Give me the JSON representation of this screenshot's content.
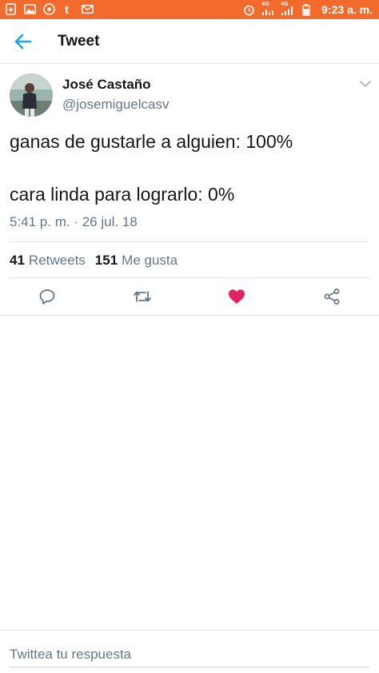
{
  "status_bar": {
    "time": "9:23 a. m.",
    "network_1": "4G",
    "network_2": "4G"
  },
  "header": {
    "title": "Tweet"
  },
  "tweet": {
    "author_name": "José Castaño",
    "author_handle": "@josemiguelcasv",
    "text_line1": "ganas de gustarle a alguien: 100%",
    "text_line2": "cara linda para lograrlo: 0%",
    "timestamp": "5:41 p. m. · 26 jul. 18",
    "retweets_count": "41",
    "retweets_label": "Retweets",
    "likes_count": "151",
    "likes_label": "Me gusta",
    "liked": true
  },
  "reply": {
    "placeholder": "Twittea tu respuesta"
  },
  "colors": {
    "status_bar": "#f26b2c",
    "accent": "#1da1f2",
    "like": "#e0245e",
    "secondary_text": "#657786"
  }
}
